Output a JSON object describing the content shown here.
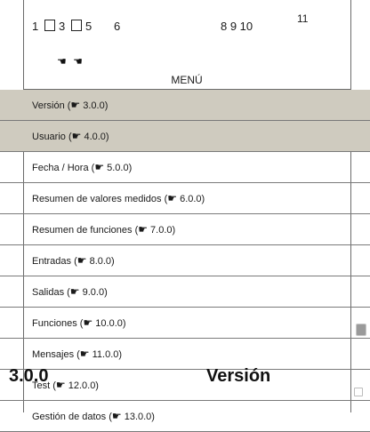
{
  "header": {
    "callouts": [
      "1",
      "3",
      "5",
      "6",
      "8 9 10",
      "11"
    ],
    "icons_row": "☚ ☚"
  },
  "menu": {
    "title": "MENÚ",
    "items": [
      {
        "label": "Versión (",
        "ref": " 3.0.0)",
        "selected": true
      },
      {
        "label": "Usuario (",
        "ref": " 4.0.0)",
        "selected": true
      },
      {
        "label": "Fecha / Hora (",
        "ref": " 5.0.0)",
        "selected": false
      },
      {
        "label": "Resumen de valores medidos (",
        "ref": " 6.0.0)",
        "selected": false
      },
      {
        "label": "Resumen de funciones (",
        "ref": " 7.0.0)",
        "selected": false
      },
      {
        "label": "Entradas (",
        "ref": " 8.0.0)",
        "selected": false
      },
      {
        "label": "Salidas (",
        "ref": " 9.0.0)",
        "selected": false
      },
      {
        "label": "Funciones (",
        "ref": " 10.0.0)",
        "selected": false
      },
      {
        "label": "Mensajes (",
        "ref": " 11.0.0)",
        "selected": false
      },
      {
        "label": "Test (",
        "ref": " 12.0.0)",
        "selected": false
      },
      {
        "label": "Gestión de datos (",
        "ref": " 13.0.0)",
        "selected": false
      }
    ]
  },
  "pointer_glyph": "☛",
  "side_arrow": "◀",
  "overlay": {
    "section_number": "3.0.0",
    "section_title": "Versión"
  }
}
